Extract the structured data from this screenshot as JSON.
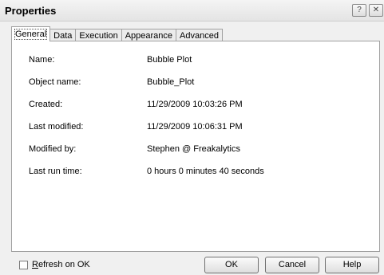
{
  "window": {
    "title": "Properties",
    "help_glyph": "?",
    "close_glyph": "✕"
  },
  "tabs": [
    {
      "label": "General"
    },
    {
      "label": "Data"
    },
    {
      "label": "Execution"
    },
    {
      "label": "Appearance"
    },
    {
      "label": "Advanced"
    }
  ],
  "general": {
    "name_label": "Name:",
    "name_value": "Bubble Plot",
    "object_name_label": "Object name:",
    "object_name_value": "Bubble_Plot",
    "created_label": "Created:",
    "created_value": "11/29/2009 10:03:26 PM",
    "modified_label": "Last modified:",
    "modified_value": "11/29/2009 10:06:31 PM",
    "modified_by_label": "Modified by:",
    "modified_by_value": "Stephen @ Freakalytics",
    "last_run_label": "Last run time:",
    "last_run_value": "0 hours 0 minutes 40 seconds"
  },
  "footer": {
    "refresh_first": "R",
    "refresh_rest": "efresh on OK",
    "ok_label": "OK",
    "cancel_label": "Cancel",
    "help_label": "Help"
  }
}
